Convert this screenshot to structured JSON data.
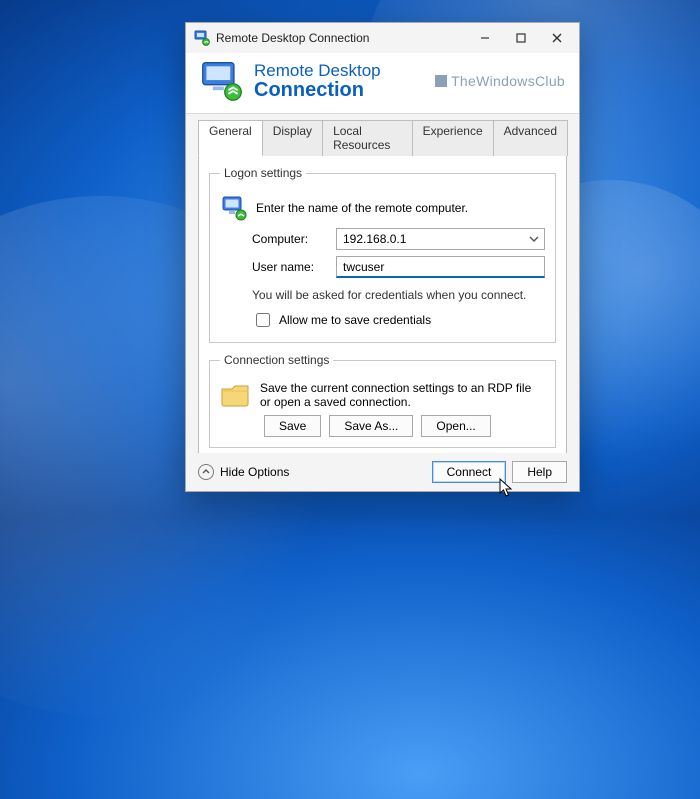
{
  "titlebar": {
    "title": "Remote Desktop Connection"
  },
  "header": {
    "line1": "Remote Desktop",
    "line2": "Connection"
  },
  "watermark": "TheWindowsClub",
  "tabs": [
    "General",
    "Display",
    "Local Resources",
    "Experience",
    "Advanced"
  ],
  "logon": {
    "legend": "Logon settings",
    "hint": "Enter the name of the remote computer.",
    "computer_label": "Computer:",
    "computer_value": "192.168.0.1",
    "username_label": "User name:",
    "username_value": "twcuser",
    "note": "You will be asked for credentials when you connect.",
    "save_cred": "Allow me to save credentials"
  },
  "conn": {
    "legend": "Connection settings",
    "desc": "Save the current connection settings to an RDP file or open a saved connection.",
    "save": "Save",
    "saveas": "Save As...",
    "open": "Open..."
  },
  "footer": {
    "hide": "Hide Options",
    "connect": "Connect",
    "help": "Help"
  }
}
